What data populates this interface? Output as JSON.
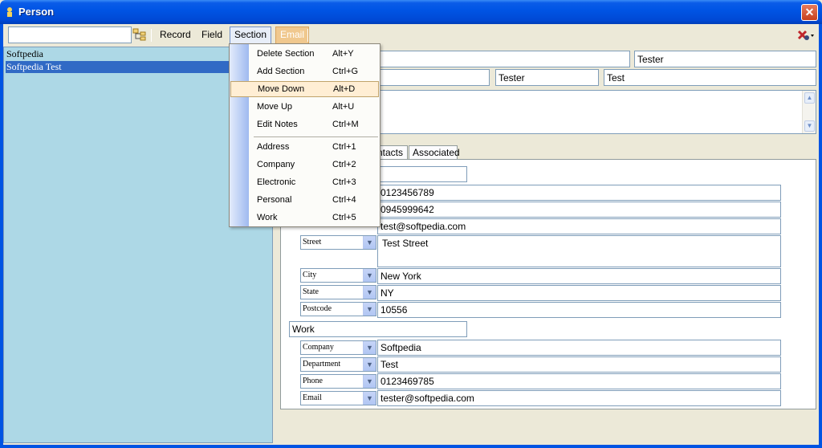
{
  "window": {
    "title": "Person"
  },
  "toolbar": {
    "search_value": "",
    "menus": [
      "Record",
      "Field",
      "Section",
      "Email"
    ]
  },
  "list": {
    "items": [
      {
        "label": "Softpedia"
      },
      {
        "label": "Softpedia Test"
      }
    ],
    "selected_index": 1
  },
  "name_fields": {
    "row1": [
      "",
      "Tester"
    ],
    "row2": [
      "",
      "Tester",
      "Test"
    ]
  },
  "tabs": [
    "ntacts",
    "Associated"
  ],
  "section_menu": {
    "items": [
      {
        "label": "Delete Section",
        "shortcut": "Alt+Y"
      },
      {
        "label": "Add Section",
        "shortcut": "Ctrl+G"
      },
      {
        "label": "Move Down",
        "shortcut": "Alt+D"
      },
      {
        "label": "Move Up",
        "shortcut": "Alt+U"
      },
      {
        "label": "Edit Notes",
        "shortcut": "Ctrl+M"
      },
      {
        "label": "Address",
        "shortcut": "Ctrl+1"
      },
      {
        "label": "Company",
        "shortcut": "Ctrl+2"
      },
      {
        "label": "Electronic",
        "shortcut": "Ctrl+3"
      },
      {
        "label": "Personal",
        "shortcut": "Ctrl+4"
      },
      {
        "label": "Work",
        "shortcut": "Ctrl+5"
      }
    ],
    "highlighted_index": 2
  },
  "contact_fields": {
    "section_title_1": "",
    "rows": [
      {
        "type": "",
        "value": "0123456789"
      },
      {
        "type": "",
        "value": "0945999642"
      },
      {
        "type": "",
        "value": "test@softpedia.com"
      },
      {
        "type": "Street",
        "value": "Test Street"
      },
      {
        "type": "City",
        "value": "New York"
      },
      {
        "type": "State",
        "value": "NY"
      },
      {
        "type": "Postcode",
        "value": "10556"
      }
    ],
    "section_title_2": "Work",
    "work_rows": [
      {
        "type": "Company",
        "value": "Softpedia"
      },
      {
        "type": "Department",
        "value": "Test"
      },
      {
        "type": "Phone",
        "value": "0123469785"
      },
      {
        "type": "Email",
        "value": "tester@softpedia.com"
      }
    ]
  }
}
